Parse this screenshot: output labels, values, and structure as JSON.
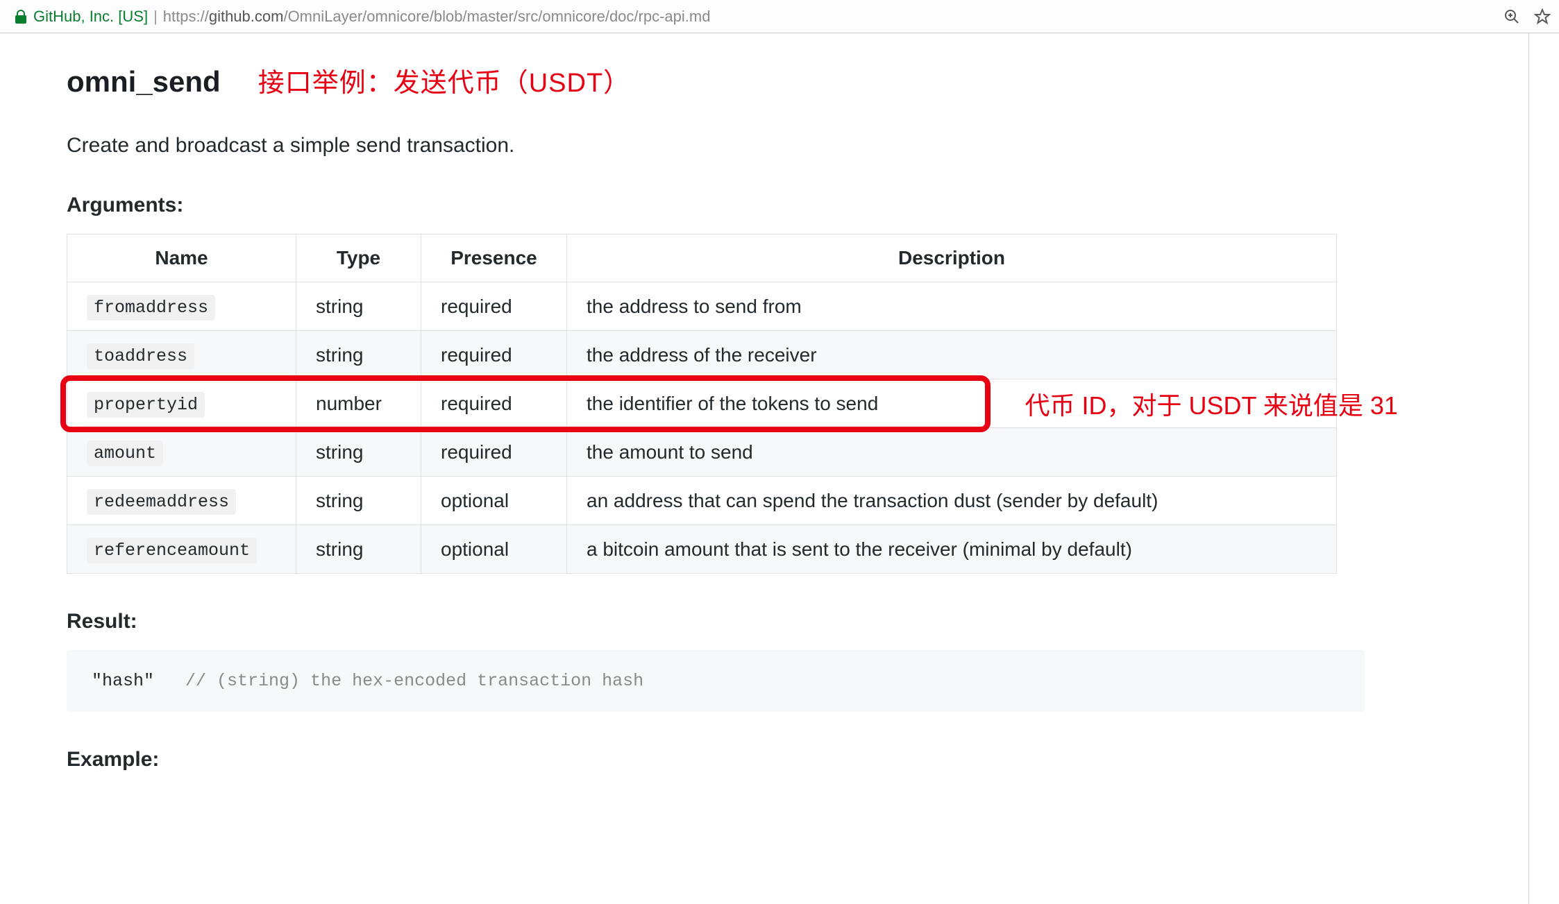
{
  "browser": {
    "site_identity": "GitHub, Inc. [US]",
    "url_scheme": "https://",
    "url_host": "github.com",
    "url_path": "/OmniLayer/omnicore/blob/master/src/omnicore/doc/rpc-api.md"
  },
  "doc": {
    "api_name": "omni_send",
    "title_annotation": "接口举例：发送代币（USDT）",
    "intro": "Create and broadcast a simple send transaction.",
    "arguments_heading": "Arguments:",
    "columns": {
      "name": "Name",
      "type": "Type",
      "presence": "Presence",
      "description": "Description"
    },
    "rows": [
      {
        "name": "fromaddress",
        "type": "string",
        "presence": "required",
        "description": "the address to send from"
      },
      {
        "name": "toaddress",
        "type": "string",
        "presence": "required",
        "description": "the address of the receiver"
      },
      {
        "name": "propertyid",
        "type": "number",
        "presence": "required",
        "description": "the identifier of the tokens to send"
      },
      {
        "name": "amount",
        "type": "string",
        "presence": "required",
        "description": "the amount to send"
      },
      {
        "name": "redeemaddress",
        "type": "string",
        "presence": "optional",
        "description": "an address that can spend the transaction dust (sender by default)"
      },
      {
        "name": "referenceamount",
        "type": "string",
        "presence": "optional",
        "description": "a bitcoin amount that is sent to the receiver (minimal by default)"
      }
    ],
    "highlight_row_index": 2,
    "highlight_annotation": "代币 ID，对于 USDT 来说值是 31",
    "result_heading": "Result:",
    "result_code_value": "\"hash\"",
    "result_code_comment": "// (string) the hex-encoded transaction hash",
    "example_heading": "Example:"
  }
}
